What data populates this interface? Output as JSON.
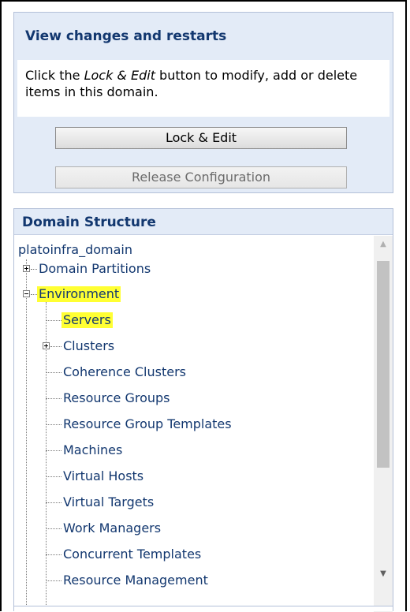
{
  "change_center": {
    "title": "View changes and restarts",
    "desc_before": "Click the ",
    "desc_em": "Lock & Edit",
    "desc_after": " button to modify, add or delete items in this domain.",
    "lock_edit_label": "Lock & Edit",
    "release_label": "Release Configuration"
  },
  "domain_structure": {
    "title": "Domain Structure",
    "root": "platoinfra_domain",
    "items": [
      {
        "label": "Domain Partitions",
        "expandable": true,
        "expanded": false
      },
      {
        "label": "Environment",
        "expandable": true,
        "expanded": true,
        "highlighted": true
      },
      {
        "label": "Servers",
        "highlighted": true
      },
      {
        "label": "Clusters",
        "expandable": true,
        "expanded": false
      },
      {
        "label": "Coherence Clusters"
      },
      {
        "label": "Resource Groups"
      },
      {
        "label": "Resource Group Templates"
      },
      {
        "label": "Machines"
      },
      {
        "label": "Virtual Hosts"
      },
      {
        "label": "Virtual Targets"
      },
      {
        "label": "Work Managers"
      },
      {
        "label": "Concurrent Templates"
      },
      {
        "label": "Resource Management"
      }
    ]
  },
  "icons": {
    "expand": "plus-box-icon",
    "collapse": "minus-box-icon",
    "scroll_up": "triangle-up-icon",
    "scroll_down": "triangle-down-icon"
  }
}
